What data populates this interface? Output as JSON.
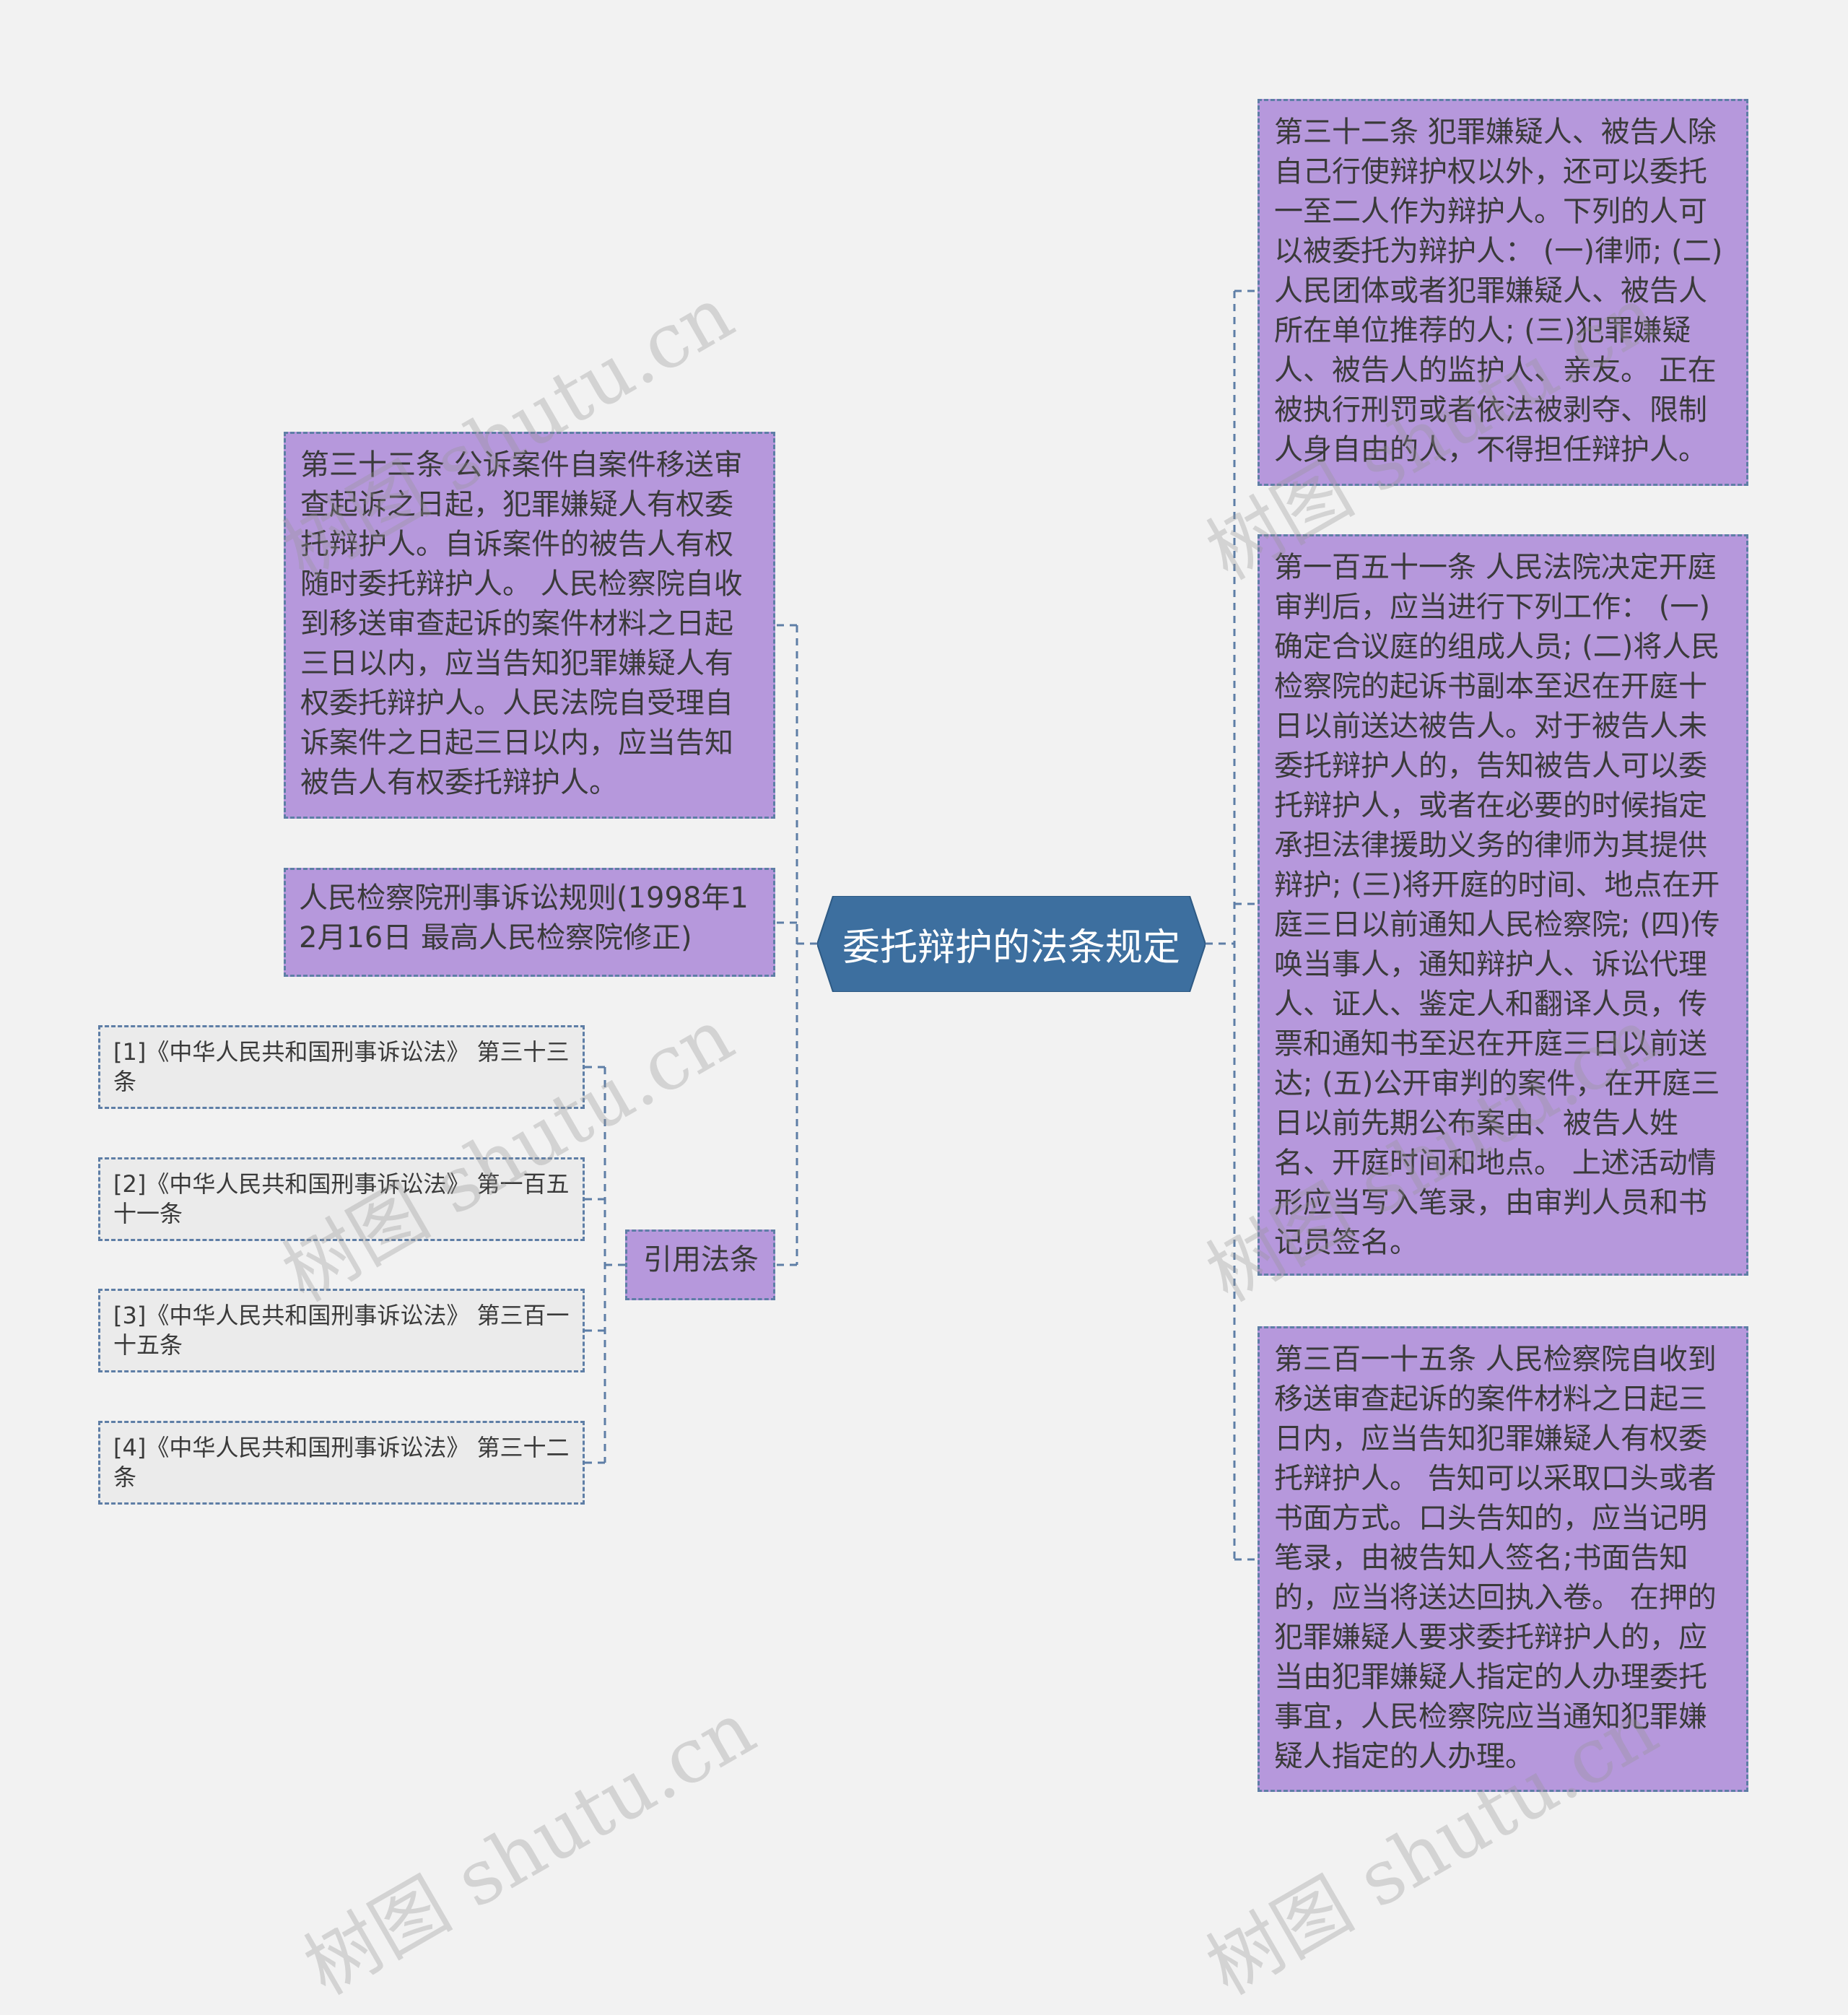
{
  "root": {
    "title": "委托辩护的法条规定"
  },
  "left": {
    "article33": "第三十三条 公诉案件自案件移送审查起诉之日起，犯罪嫌疑人有权委托辩护人。自诉案件的被告人有权随时委托辩护人。 人民检察院自收到移送审查起诉的案件材料之日起三日以内，应当告知犯罪嫌疑人有权委托辩护人。人民法院自受理自诉案件之日起三日以内，应当告知被告人有权委托辩护人。",
    "rules": "人民检察院刑事诉讼规则(1998年12月16日 最高人民检察院修正)",
    "citations_label": "引用法条",
    "citations": [
      "[1]《中华人民共和国刑事诉讼法》 第三十三条",
      "[2]《中华人民共和国刑事诉讼法》 第一百五十一条",
      "[3]《中华人民共和国刑事诉讼法》 第三百一十五条",
      "[4]《中华人民共和国刑事诉讼法》 第三十二条"
    ]
  },
  "right": {
    "article32": "第三十二条 犯罪嫌疑人、被告人除自己行使辩护权以外，还可以委托一至二人作为辩护人。下列的人可以被委托为辩护人： (一)律师; (二)人民团体或者犯罪嫌疑人、被告人所在单位推荐的人; (三)犯罪嫌疑人、被告人的监护人、亲友。 正在被执行刑罚或者依法被剥夺、限制人身自由的人，不得担任辩护人。",
    "article151": "第一百五十一条 人民法院决定开庭审判后，应当进行下列工作： (一)确定合议庭的组成人员; (二)将人民检察院的起诉书副本至迟在开庭十日以前送达被告人。对于被告人未委托辩护人的，告知被告人可以委托辩护人，或者在必要的时候指定承担法律援助义务的律师为其提供辩护; (三)将开庭的时间、地点在开庭三日以前通知人民检察院; (四)传唤当事人，通知辩护人、诉讼代理人、证人、鉴定人和翻译人员，传票和通知书至迟在开庭三日以前送达; (五)公开审判的案件，在开庭三日以前先期公布案由、被告人姓名、开庭时间和地点。 上述活动情形应当写入笔录，由审判人员和书记员签名。",
    "article315": "第三百一十五条 人民检察院自收到移送审查起诉的案件材料之日起三日内，应当告知犯罪嫌疑人有权委托辩护人。 告知可以采取口头或者书面方式。口头告知的，应当记明笔录，由被告知人签名;书面告知的，应当将送达回执入卷。 在押的犯罪嫌疑人要求委托辩护人的，应当由犯罪嫌疑人指定的人办理委托事宜，人民检察院应当通知犯罪嫌疑人指定的人办理。"
  },
  "watermark": "树图 shutu.cn",
  "colors": {
    "background": "#f2f2f2",
    "root_fill": "#3d6f9f",
    "node_fill": "#b698dc",
    "ref_fill": "#ebebeb",
    "connector": "#5e7ea6",
    "text": "#3a3a3a"
  }
}
